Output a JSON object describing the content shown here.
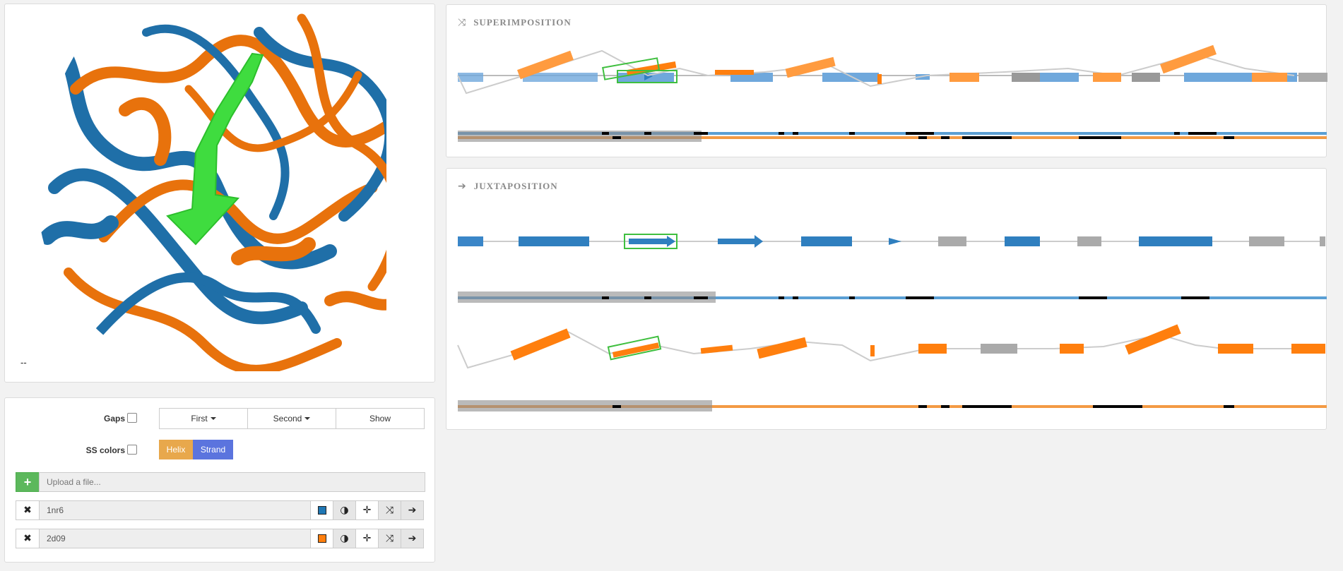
{
  "viewer": {
    "status_text": "--"
  },
  "superimposition": {
    "title": "SUPERIMPOSITION",
    "icon": "shuffle-icon"
  },
  "juxtaposition": {
    "title": "JUXTAPOSITION",
    "icon": "arrow-right-icon"
  },
  "controls": {
    "gaps_label": "Gaps",
    "ss_colors_label": "SS colors",
    "first_label": "First",
    "second_label": "Second",
    "show_label": "Show",
    "helix_label": "Helix",
    "strand_label": "Strand",
    "upload_placeholder": "Upload a file...",
    "add_icon": "plus-icon"
  },
  "structures": [
    {
      "name": "1nr6",
      "color": "#1f77b4"
    },
    {
      "name": "2d09",
      "color": "#ff7f0e"
    }
  ],
  "colors": {
    "blue": "#2f7fbf",
    "orange": "#ff7f0e",
    "green": "#3fbf3f",
    "helix": "#e8a84c",
    "strand": "#5b74de",
    "add": "#5cb85c"
  }
}
